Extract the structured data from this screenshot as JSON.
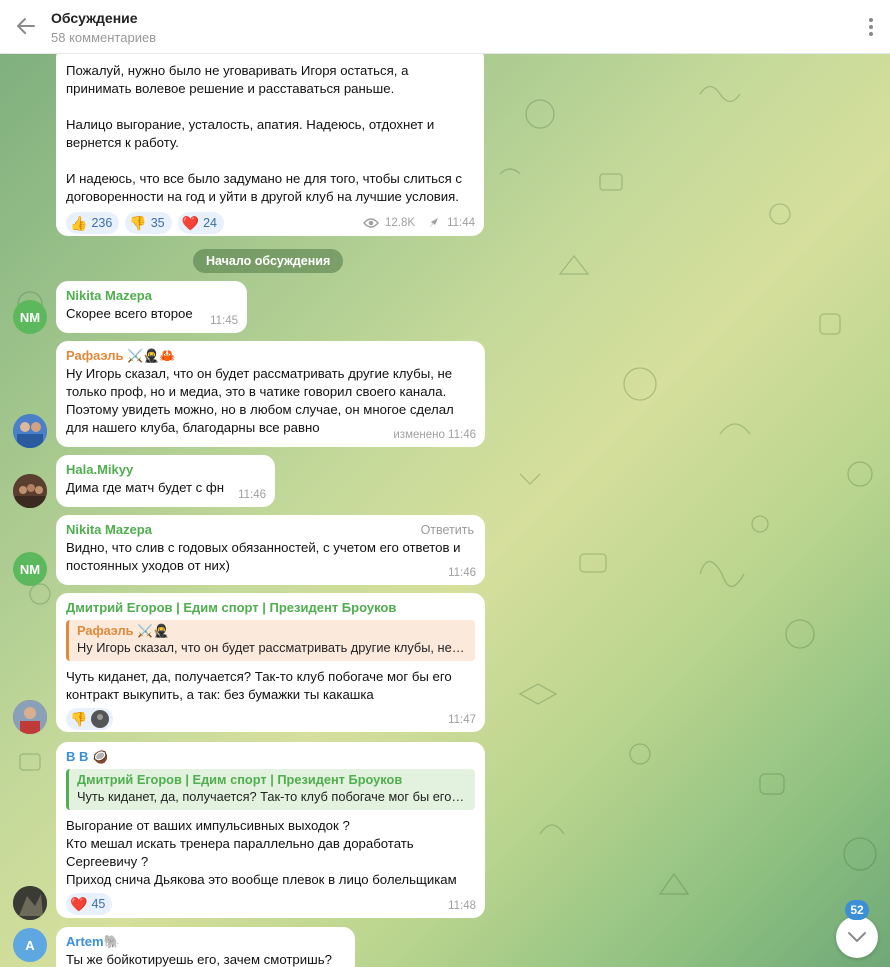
{
  "header": {
    "title": "Обсуждение",
    "subtitle": "58 комментариев"
  },
  "top_post": {
    "paragraphs": [
      "Пожалуй, нужно было не уговаривать Игоря остаться, а принимать волевое решение и расставаться раньше.",
      "Налицо выгорание, усталость, апатия. Надеюсь, отдохнет и вернется к работу.",
      "И надеюсь, что все было задумано не для того, чтобы слиться с договоренности на год и уйти в другой клуб на лучшие условия."
    ],
    "reactions": [
      {
        "emoji": "👍",
        "count": "236"
      },
      {
        "emoji": "👎",
        "count": "35"
      },
      {
        "emoji": "❤️",
        "count": "24"
      }
    ],
    "views": "12.8K",
    "time": "11:44"
  },
  "divider": "Начало обсуждения",
  "messages": [
    {
      "name": "Nikita Mazepa",
      "initials": "NM",
      "text": "Скорее всего второе",
      "time": "11:45",
      "name_color": "#4fae4e"
    },
    {
      "name": "Рафаэль ⚔️🥷🦀",
      "text": "Ну Игорь сказал, что он будет рассматривать другие клубы, не только проф, но и медиа, это в чатике говорил своего канала. Поэтому увидеть можно, но в любом случае, он многое сделал для нашего клуба, благодарны все равно",
      "time": "изменено 11:46",
      "name_color": "#e08a3c"
    },
    {
      "name": "Hala.Mikyy",
      "text": "Дима где матч будет с фн",
      "time": "11:46",
      "name_color": "#4fae4e"
    },
    {
      "name": "Nikita Mazepa",
      "initials": "NM",
      "reply_label": "Ответить",
      "text": "Видно, что слив с годовых обязанностей, с учетом его ответов и постоянных уходов от них)",
      "time": "11:46",
      "name_color": "#4fae4e"
    },
    {
      "name": "Дмитрий Егоров | Едим спорт | Президент Броуков",
      "quote_name": "Рафаэль ⚔️🥷",
      "quote_text": "Ну Игорь сказал, что он будет рассматривать другие клубы, не только проф, но и медиа",
      "text": "Чуть киданет, да, получается?  Так-то клуб побогаче мог бы его контракт выкупить, а так: без бумажки ты какашка",
      "time": "11:47",
      "name_color": "#4fae4e"
    },
    {
      "name": "В В 🥥",
      "quote_name": "Дмитрий Егоров | Едим спорт | Президент Броуков",
      "quote_text": "Чуть киданет, да, получается?  Так-то клуб побогаче мог бы его контракт выкупить",
      "lines": [
        "Выгорание от ваших импульсивных выходок ?",
        "Кто мешал искать тренера параллельно дав доработать",
        "Сергеевичу ?",
        "Приход снича Дьякова это вообще плевок в лицо болельщикам"
      ],
      "reaction_count": "45",
      "time": "11:48",
      "name_color": "#3a8fd6"
    },
    {
      "name": "Artem🐘",
      "initials": "A",
      "text": "Ты же бойкотируешь его, зачем смотришь?",
      "name_color": "#3a8fd6"
    }
  ],
  "scroll": {
    "unread": "52"
  },
  "colors": {
    "accent": "#3a8fd6",
    "header_bg": "#ffffff",
    "bubble_bg": "#ffffff"
  }
}
